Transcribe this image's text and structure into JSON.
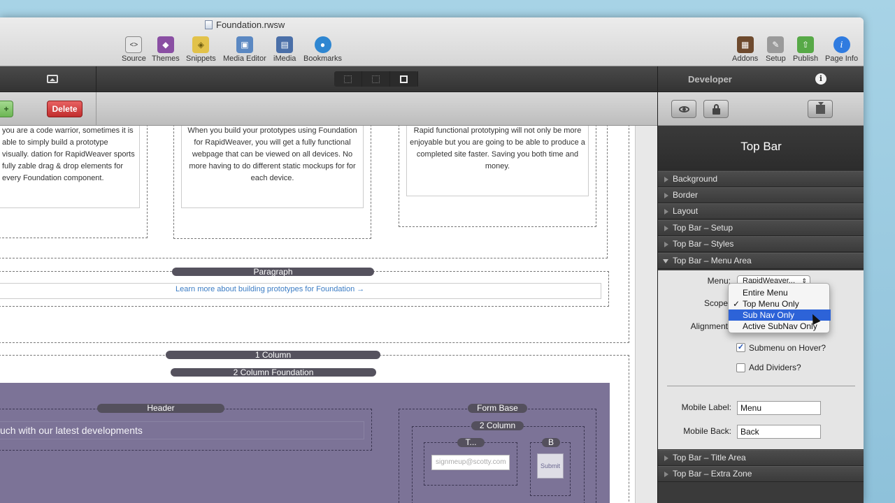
{
  "window": {
    "title": "Foundation.rwsw"
  },
  "toolbar": {
    "left": [
      {
        "name": "source",
        "label": "Source",
        "icon": "source-icon",
        "color": "#d9d9d9"
      },
      {
        "name": "themes",
        "label": "Themes",
        "icon": "themes-icon",
        "color": "#8a4fa3"
      },
      {
        "name": "snippets",
        "label": "Snippets",
        "icon": "snippets-icon",
        "color": "#e2c24a"
      },
      {
        "name": "media-editor",
        "label": "Media Editor",
        "icon": "media-editor-icon",
        "color": "#5b88c2"
      },
      {
        "name": "imedia",
        "label": "iMedia",
        "icon": "imedia-icon",
        "color": "#4a6fa8"
      },
      {
        "name": "bookmarks",
        "label": "Bookmarks",
        "icon": "bookmarks-icon",
        "color": "#2e86d1"
      }
    ],
    "right": [
      {
        "name": "addons",
        "label": "Addons",
        "icon": "addons-icon",
        "color": "#6e4a2e"
      },
      {
        "name": "setup",
        "label": "Setup",
        "icon": "setup-icon",
        "color": "#9a9a9a"
      },
      {
        "name": "publish",
        "label": "Publish",
        "icon": "publish-icon",
        "color": "#57a947"
      },
      {
        "name": "page-info",
        "label": "Page Info",
        "icon": "page-info-icon",
        "color": "#2f7be0"
      }
    ]
  },
  "action_bar": {
    "delete_label": "Delete",
    "add_label": "+"
  },
  "canvas": {
    "cards": [
      "you are a code warrior, sometimes it is able to simply build a prototype visually. dation for RapidWeaver sports fully zable drag & drop elements for every Foundation component.",
      "When you build your prototypes using Foundation for RapidWeaver, you will get a fully functional webpage that can be viewed on all devices. No more having to do different static mockups for for each device.",
      "Rapid functional prototyping will not only be more enjoyable but you are going to be able to produce a completed site faster. Saving you both time and money."
    ],
    "paragraph_label": "Paragraph",
    "link_text": "Learn more about building prototypes for Foundation →",
    "one_column_label": "1 Column",
    "two_col_foundation_label": "2 Column Foundation",
    "header_label": "Header",
    "header_text": "uch with our latest developments",
    "form_base_label": "Form Base",
    "two_column_label": "2 Column",
    "t_label": "T...",
    "b_label": "B",
    "email_placeholder": "signmeup@scotty.com",
    "submit_label": "Submit"
  },
  "inspector": {
    "header": "Developer",
    "panel_title": "Top Bar",
    "sections_top": [
      "Background",
      "Border",
      "Layout",
      "Top Bar – Setup",
      "Top Bar – Styles"
    ],
    "expanded_section": "Top Bar – Menu Area",
    "menu_label": "Menu:",
    "menu_value": "RapidWeaver...",
    "scope_label": "Scope",
    "alignment_label": "Alignment",
    "scope_options": [
      {
        "label": "Entire Menu",
        "checked": false,
        "selected": false
      },
      {
        "label": "Top Menu Only",
        "checked": true,
        "selected": false
      },
      {
        "label": "Sub Nav Only",
        "checked": false,
        "selected": true
      },
      {
        "label": "Active SubNav Only",
        "checked": false,
        "selected": false
      }
    ],
    "submenu_hover_label": "Submenu on Hover?",
    "submenu_hover_checked": true,
    "add_dividers_label": "Add Dividers?",
    "add_dividers_checked": false,
    "mobile_label_label": "Mobile Label:",
    "mobile_label_value": "Menu",
    "mobile_back_label": "Mobile Back:",
    "mobile_back_value": "Back",
    "sections_bottom": [
      "Top Bar – Title Area",
      "Top Bar – Extra Zone"
    ]
  },
  "colors": {
    "purple_bg": "#7c7397",
    "accent_blue": "#2d63d8",
    "delete_red": "#c12d2d"
  }
}
